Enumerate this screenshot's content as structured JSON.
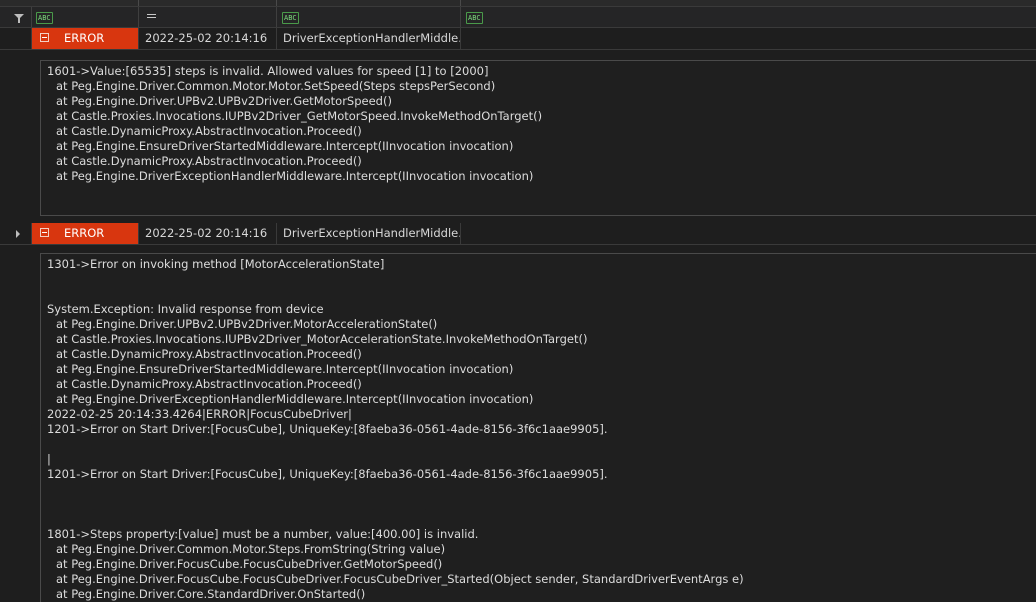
{
  "grid": {
    "columns": [
      {
        "type_icon": "abc-icon",
        "label": "ABC"
      },
      {
        "type_icon": "equals-icon",
        "label": ""
      },
      {
        "type_icon": "abc-icon",
        "label": "ABC"
      },
      {
        "type_icon": "abc-icon",
        "label": "ABC"
      }
    ]
  },
  "rows": [
    {
      "level": "ERROR",
      "timestamp": "2022-25-02 20:14:16",
      "source": "DriverExceptionHandlerMiddle...",
      "expanded": true,
      "detail": [
        {
          "text": "1601->Value:[65535] steps is invalid. Allowed values for speed [1] to [2000]",
          "indent": false
        },
        {
          "text": "at Peg.Engine.Driver.Common.Motor.Motor.SetSpeed(Steps stepsPerSecond)",
          "indent": true
        },
        {
          "text": "at Peg.Engine.Driver.UPBv2.UPBv2Driver.GetMotorSpeed()",
          "indent": true
        },
        {
          "text": "at Castle.Proxies.Invocations.IUPBv2Driver_GetMotorSpeed.InvokeMethodOnTarget()",
          "indent": true
        },
        {
          "text": "at Castle.DynamicProxy.AbstractInvocation.Proceed()",
          "indent": true
        },
        {
          "text": "at Peg.Engine.EnsureDriverStartedMiddleware.Intercept(IInvocation invocation)",
          "indent": true
        },
        {
          "text": "at Castle.DynamicProxy.AbstractInvocation.Proceed()",
          "indent": true
        },
        {
          "text": "at Peg.Engine.DriverExceptionHandlerMiddleware.Intercept(IInvocation invocation)",
          "indent": true
        }
      ]
    },
    {
      "level": "ERROR",
      "timestamp": "2022-25-02 20:14:16",
      "source": "DriverExceptionHandlerMiddle...",
      "expanded": false,
      "detail": [
        {
          "text": "1301->Error on invoking method [MotorAccelerationState]",
          "indent": false
        },
        {
          "text": "",
          "indent": false
        },
        {
          "text": "",
          "indent": false
        },
        {
          "text": "System.Exception: Invalid response from device",
          "indent": false
        },
        {
          "text": "at Peg.Engine.Driver.UPBv2.UPBv2Driver.MotorAccelerationState()",
          "indent": true
        },
        {
          "text": "at Castle.Proxies.Invocations.IUPBv2Driver_MotorAccelerationState.InvokeMethodOnTarget()",
          "indent": true
        },
        {
          "text": "at Castle.DynamicProxy.AbstractInvocation.Proceed()",
          "indent": true
        },
        {
          "text": "at Peg.Engine.EnsureDriverStartedMiddleware.Intercept(IInvocation invocation)",
          "indent": true
        },
        {
          "text": "at Castle.DynamicProxy.AbstractInvocation.Proceed()",
          "indent": true
        },
        {
          "text": "at Peg.Engine.DriverExceptionHandlerMiddleware.Intercept(IInvocation invocation)",
          "indent": true
        },
        {
          "text": "2022-02-25 20:14:33.4264|ERROR|FocusCubeDriver|",
          "indent": false
        },
        {
          "text": "1201->Error on Start Driver:[FocusCube], UniqueKey:[8faeba36-0561-4ade-8156-3f6c1aae9905].",
          "indent": false
        },
        {
          "text": "",
          "indent": false
        },
        {
          "text": "|",
          "indent": false
        },
        {
          "text": "1201->Error on Start Driver:[FocusCube], UniqueKey:[8faeba36-0561-4ade-8156-3f6c1aae9905].",
          "indent": false
        },
        {
          "text": "",
          "indent": false
        },
        {
          "text": "",
          "indent": false
        },
        {
          "text": "",
          "indent": false
        },
        {
          "text": "1801->Steps property:[value] must be a number, value:[400.00] is invalid.",
          "indent": false
        },
        {
          "text": "at Peg.Engine.Driver.Common.Motor.Steps.FromString(String value)",
          "indent": true
        },
        {
          "text": "at Peg.Engine.Driver.FocusCube.FocusCubeDriver.GetMotorSpeed()",
          "indent": true
        },
        {
          "text": "at Peg.Engine.Driver.FocusCube.FocusCubeDriver.FocusCubeDriver_Started(Object sender, StandardDriverEventArgs e)",
          "indent": true
        },
        {
          "text": "at Peg.Engine.Driver.Core.StandardDriver.OnStarted()",
          "indent": true
        }
      ]
    }
  ]
}
